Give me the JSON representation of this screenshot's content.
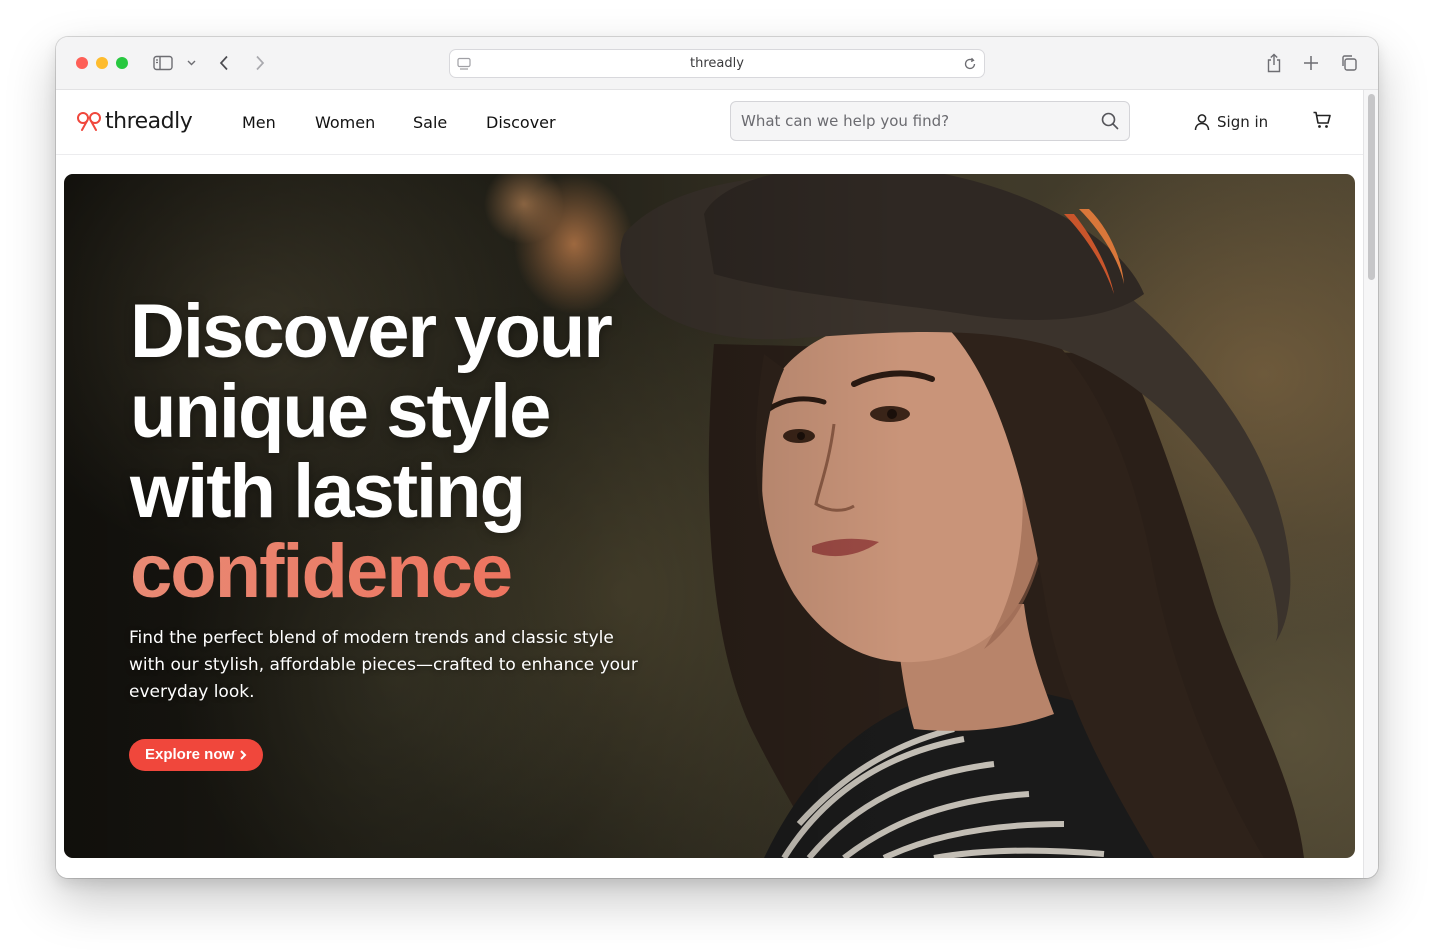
{
  "browser": {
    "url": "threadly"
  },
  "header": {
    "logo": "threadly",
    "nav": [
      {
        "label": "Men"
      },
      {
        "label": "Women"
      },
      {
        "label": "Sale"
      },
      {
        "label": "Discover"
      }
    ],
    "search_placeholder": "What can we help you find?",
    "sign_in": "Sign in"
  },
  "hero": {
    "headline_lines": [
      "Discover your",
      "unique style",
      "with lasting"
    ],
    "headline_accent": "confidence",
    "subtext": "Find the perfect blend of modern trends and classic style with our stylish, affordable pieces—crafted to enhance your everyday look.",
    "cta": "Explore now",
    "accent_color": "#f0473c"
  }
}
